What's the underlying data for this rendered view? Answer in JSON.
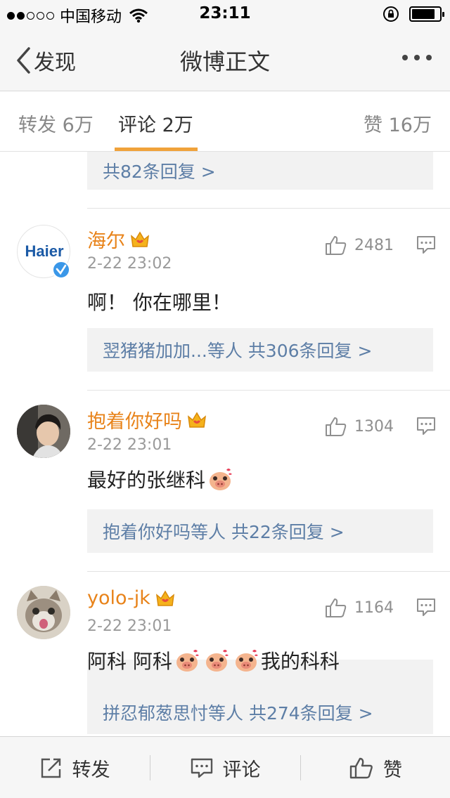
{
  "status_bar": {
    "carrier": "中国移动",
    "time": "23:11",
    "signal_bars_filled": 2,
    "signal_bars_total": 5,
    "battery_level": 0.85
  },
  "nav": {
    "back_label": "发现",
    "title": "微博正文"
  },
  "tabs": [
    {
      "label": "转发 6万",
      "active": false
    },
    {
      "label": "评论 2万",
      "active": true
    },
    {
      "label": "赞 16万",
      "active": false
    }
  ],
  "previous_reply_summary": "共82条回复 >",
  "comments": [
    {
      "name": "海尔",
      "time": "2-22 23:02",
      "text": "啊！ 你在哪里！",
      "likes": "2481",
      "reply_summary": "翌猪猪加加...等人  共306条回复 >",
      "avatar_text": "Haier",
      "verified": true
    },
    {
      "name": "抱着你好吗",
      "time": "2-22 23:01",
      "text": "最好的张继科",
      "likes": "1304",
      "reply_summary": "抱着你好吗等人  共22条回复 >"
    },
    {
      "name": "yolo-jk",
      "time": "2-22 23:01",
      "text_parts": [
        "阿科 阿科",
        "我的科科"
      ],
      "likes": "1164",
      "reply_summary": "拼忍郁葱思忖等人  共274条回复 >"
    }
  ],
  "bottom_bar": {
    "repost": "转发",
    "comment": "评论",
    "like": "赞"
  },
  "colors": {
    "accent": "#f0a23a",
    "username": "#e8831a",
    "link": "#5d7ea6",
    "reply_bg": "#f2f2f2"
  }
}
